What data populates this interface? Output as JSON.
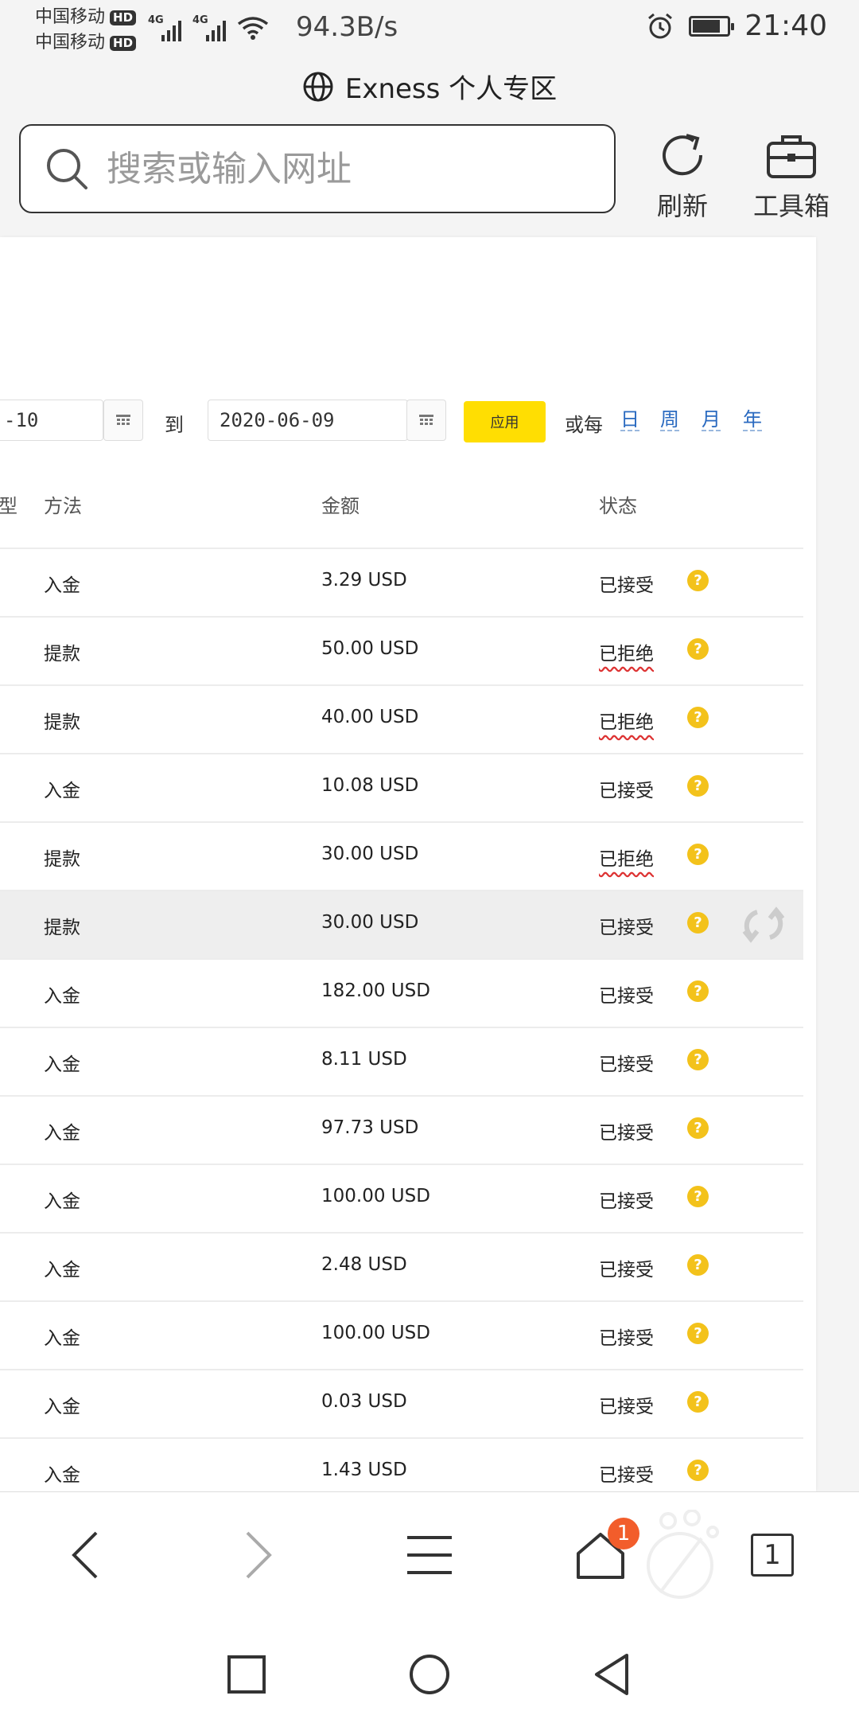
{
  "status_bar": {
    "carrier1": "中国移动",
    "carrier2": "中国移动",
    "hd_label": "HD",
    "network_type": "4G",
    "net_speed": "94.3B/s",
    "time": "21:40",
    "battery_level": 0.8
  },
  "page_title": "Exness 个人专区",
  "browser": {
    "search_placeholder": "搜索或输入网址",
    "refresh_label": "刷新",
    "toolbox_label": "工具箱"
  },
  "filters": {
    "date_from_partial": "-10",
    "to_label": "到",
    "date_to": "2020-06-09",
    "apply_label": "应用",
    "per_label": "或每",
    "periods": [
      "日",
      "周",
      "月",
      "年"
    ]
  },
  "table": {
    "headers": {
      "type_partial": "类型",
      "method": "方法",
      "amount": "金额",
      "status": "状态"
    },
    "rows": [
      {
        "method": "入金",
        "amount": "3.29 USD",
        "status": "已接受"
      },
      {
        "method": "提款",
        "amount": "50.00 USD",
        "status": "已拒绝"
      },
      {
        "method": "提款",
        "amount": "40.00 USD",
        "status": "已拒绝"
      },
      {
        "method": "入金",
        "amount": "10.08 USD",
        "status": "已接受"
      },
      {
        "method": "提款",
        "amount": "30.00 USD",
        "status": "已拒绝"
      },
      {
        "method": "提款",
        "amount": "30.00 USD",
        "status": "已接受"
      },
      {
        "method": "入金",
        "amount": "182.00 USD",
        "status": "已接受"
      },
      {
        "method": "入金",
        "amount": "8.11 USD",
        "status": "已接受"
      },
      {
        "method": "入金",
        "amount": "97.73 USD",
        "status": "已接受"
      },
      {
        "method": "入金",
        "amount": "100.00 USD",
        "status": "已接受"
      },
      {
        "method": "入金",
        "amount": "2.48 USD",
        "status": "已接受"
      },
      {
        "method": "入金",
        "amount": "100.00 USD",
        "status": "已接受"
      },
      {
        "method": "入金",
        "amount": "0.03 USD",
        "status": "已接受"
      },
      {
        "method": "入金",
        "amount": "1.43 USD",
        "status": "已接受"
      }
    ]
  },
  "bottom_nav": {
    "home_badge": "1",
    "tab_count": "1"
  },
  "colors": {
    "accent_yellow": "#ffde02",
    "link_blue": "#2a6ac0",
    "help_icon": "#f3c21b",
    "badge_orange": "#f25d2b"
  }
}
